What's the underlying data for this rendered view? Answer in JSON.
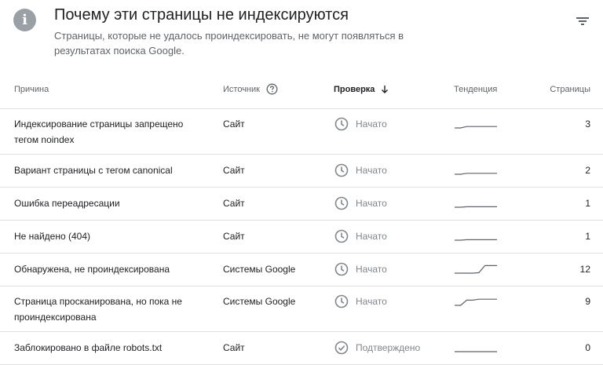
{
  "header": {
    "title": "Почему эти страницы не индексируются",
    "subtitle": "Страницы, которые не удалось проиндексировать, не могут появляться в результатах поиска Google."
  },
  "table": {
    "headers": {
      "reason": "Причина",
      "source": "Источник",
      "check": "Проверка",
      "trend": "Тенденция",
      "pages": "Страницы"
    },
    "rows": [
      {
        "reason": "Индексирование страницы запрещено тегом noindex",
        "source": "Сайт",
        "status": "Начато",
        "status_icon": "clock-icon",
        "pages": "3",
        "trend": [
          0.0,
          0.0,
          0.15,
          0.15,
          0.15,
          0.15,
          0.15,
          0.15
        ]
      },
      {
        "reason": "Вариант страницы с тегом canonical",
        "source": "Сайт",
        "status": "Начато",
        "status_icon": "clock-icon",
        "pages": "2",
        "trend": [
          0.0,
          0.0,
          0.1,
          0.1,
          0.1,
          0.1,
          0.1,
          0.1
        ]
      },
      {
        "reason": "Ошибка переадресации",
        "source": "Сайт",
        "status": "Начато",
        "status_icon": "clock-icon",
        "pages": "1",
        "trend": [
          0.0,
          0.0,
          0.05,
          0.05,
          0.05,
          0.05,
          0.05,
          0.05
        ]
      },
      {
        "reason": "Не найдено (404)",
        "source": "Сайт",
        "status": "Начато",
        "status_icon": "clock-icon",
        "pages": "1",
        "trend": [
          0.0,
          0.0,
          0.05,
          0.05,
          0.05,
          0.05,
          0.05,
          0.05
        ]
      },
      {
        "reason": "Обнаружена, не проиндексирована",
        "source": "Системы Google",
        "status": "Начато",
        "status_icon": "clock-icon",
        "pages": "12",
        "trend": [
          0.0,
          0.0,
          0.0,
          0.0,
          0.05,
          0.8,
          0.8,
          0.8
        ]
      },
      {
        "reason": "Страница просканирована, но пока не проиндексирована",
        "source": "Системы Google",
        "status": "Начато",
        "status_icon": "clock-icon",
        "pages": "9",
        "trend": [
          0.0,
          0.0,
          0.55,
          0.55,
          0.65,
          0.65,
          0.65,
          0.65
        ]
      },
      {
        "reason": "Заблокировано в файле robots.txt",
        "source": "Сайт",
        "status": "Подтверждено",
        "status_icon": "check-circle-icon",
        "pages": "0",
        "trend": [
          0.0,
          0.0,
          0.0,
          0.0,
          0.0,
          0.0,
          0.0,
          0.0
        ]
      }
    ]
  },
  "colors": {
    "icon_grey": "#80868b",
    "text_secondary": "#5f6368",
    "divider": "#e0e0e0"
  },
  "icons": {
    "header": "info-icon",
    "filter": "filter-icon",
    "help": "help-circle-icon",
    "sort": "arrow-down-icon"
  }
}
